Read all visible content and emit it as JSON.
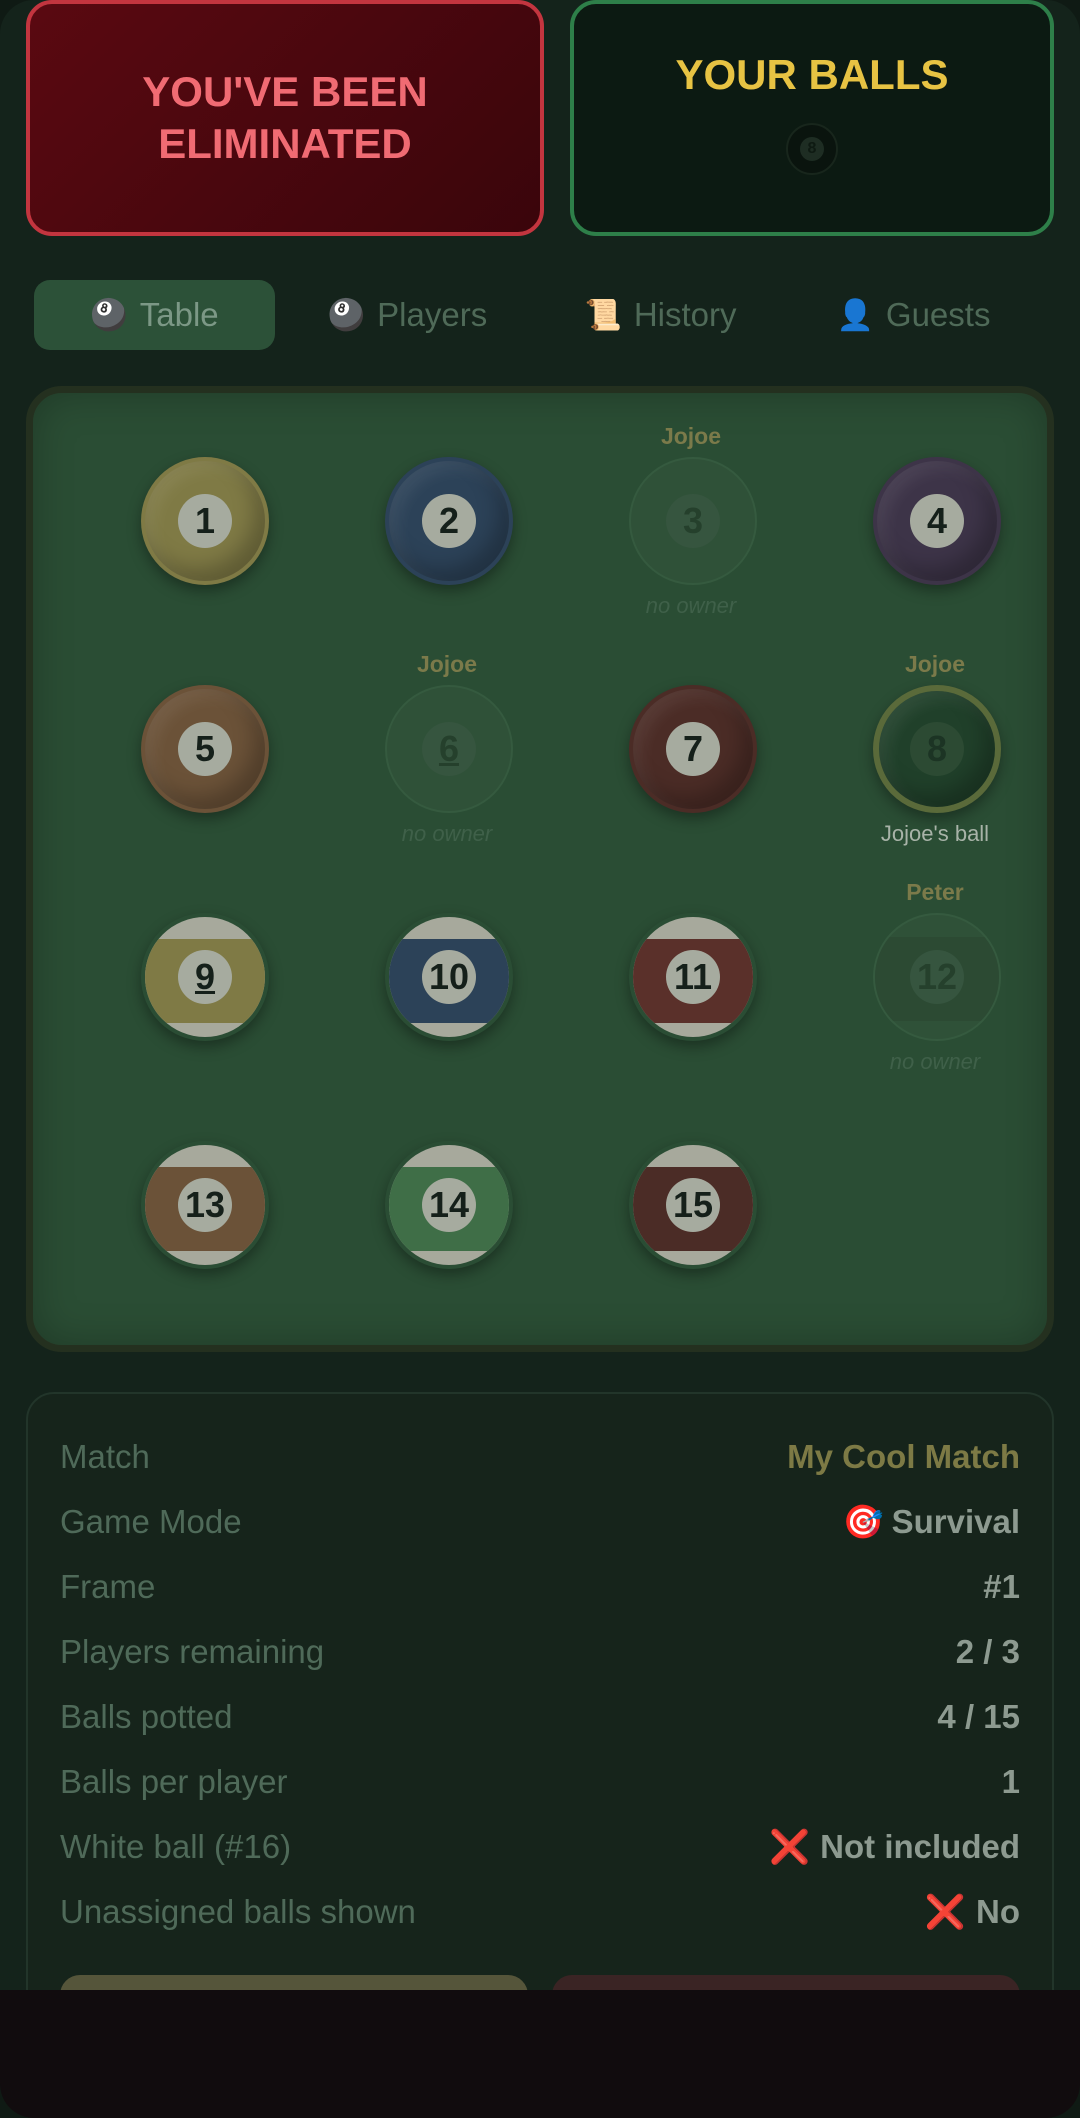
{
  "status_card": {
    "title": "YOU'VE BEEN ELIMINATED"
  },
  "balls_card": {
    "title": "YOUR BALLS",
    "ball_number": "8"
  },
  "tabs": [
    {
      "icon": "🎱",
      "label": "Table",
      "active": true
    },
    {
      "icon": "🎱",
      "label": "Players",
      "active": false
    },
    {
      "icon": "📜",
      "label": "History",
      "active": false
    },
    {
      "icon": "👤",
      "label": "Guests",
      "active": false
    }
  ],
  "table": {
    "balls": [
      {
        "number": "1",
        "color": "#7f7a45",
        "type": "solid",
        "owner": "",
        "caption": "",
        "state": "normal"
      },
      {
        "number": "2",
        "color": "#2c4258",
        "type": "solid",
        "owner": "",
        "caption": "",
        "state": "normal"
      },
      {
        "number": "3",
        "color": "#2f5138",
        "type": "solid",
        "owner": "Jojoe",
        "caption": "no owner",
        "state": "ghost"
      },
      {
        "number": "4",
        "color": "#3d3448",
        "type": "solid",
        "owner": "",
        "caption": "",
        "state": "normal"
      },
      {
        "number": "5",
        "color": "#6b5238",
        "type": "solid",
        "owner": "",
        "caption": "",
        "state": "normal"
      },
      {
        "number": "6",
        "color": "#2f5138",
        "type": "solid",
        "owner": "Jojoe",
        "caption": "no owner",
        "state": "ghost"
      },
      {
        "number": "7",
        "color": "#4b2c26",
        "type": "solid",
        "owner": "",
        "caption": "",
        "state": "normal"
      },
      {
        "number": "8",
        "color": "#20402a",
        "type": "solid",
        "owner": "Jojoe",
        "caption": "Jojoe's ball",
        "state": "ring"
      },
      {
        "number": "9",
        "color": "#7f7a45",
        "type": "stripe",
        "owner": "",
        "caption": "",
        "state": "normal"
      },
      {
        "number": "10",
        "color": "#2c4258",
        "type": "stripe",
        "owner": "",
        "caption": "",
        "state": "normal"
      },
      {
        "number": "11",
        "color": "#5a302a",
        "type": "stripe",
        "owner": "",
        "caption": "",
        "state": "normal"
      },
      {
        "number": "12",
        "color": "#2f5138",
        "type": "stripe",
        "owner": "Peter",
        "caption": "no owner",
        "state": "ghost"
      },
      {
        "number": "13",
        "color": "#6b5238",
        "type": "stripe",
        "owner": "",
        "caption": "",
        "state": "normal"
      },
      {
        "number": "14",
        "color": "#3f6e47",
        "type": "stripe",
        "owner": "",
        "caption": "",
        "state": "normal"
      },
      {
        "number": "15",
        "color": "#4b2c26",
        "type": "stripe",
        "owner": "",
        "caption": "",
        "state": "normal"
      }
    ]
  },
  "info": {
    "rows": [
      {
        "key": "Match",
        "value": "My Cool Match",
        "emoji": "",
        "style": "gold"
      },
      {
        "key": "Game Mode",
        "value": "Survival",
        "emoji": "🎯",
        "style": "normal"
      },
      {
        "key": "Frame",
        "value": "#1",
        "emoji": "",
        "style": "normal"
      },
      {
        "key": "Players remaining",
        "value": "2 / 3",
        "emoji": "",
        "style": "normal"
      },
      {
        "key": "Balls potted",
        "value": "4 / 15",
        "emoji": "",
        "style": "normal"
      },
      {
        "key": "Balls per player",
        "value": "1",
        "emoji": "",
        "style": "normal"
      },
      {
        "key": "White ball (#16)",
        "value": "Not included",
        "emoji": "❌",
        "style": "normal"
      },
      {
        "key": "Unassigned balls shown",
        "value": "No",
        "emoji": "❌",
        "style": "normal"
      }
    ]
  }
}
